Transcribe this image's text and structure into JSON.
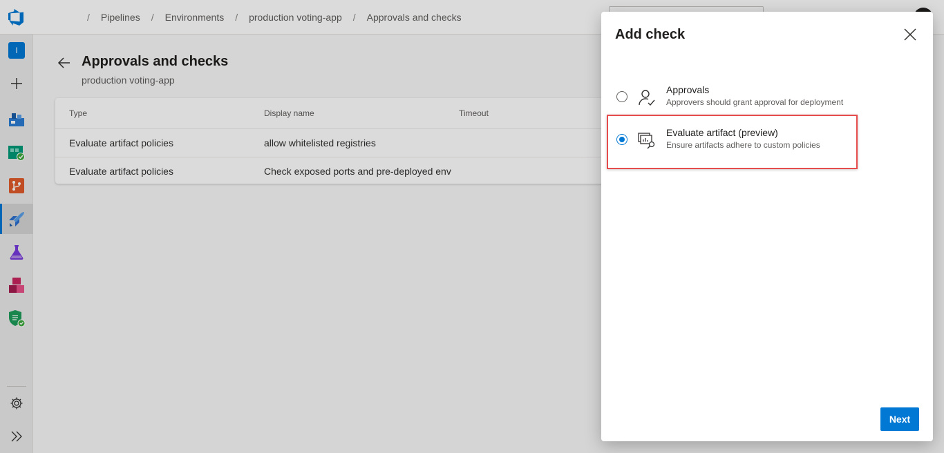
{
  "header": {
    "breadcrumbs": [
      {
        "label": "",
        "blurred": true
      },
      {
        "label": "",
        "blurred": true
      },
      {
        "label": "Pipelines",
        "blurred": false
      },
      {
        "label": "Environments",
        "blurred": false
      },
      {
        "label": "production voting-app",
        "blurred": false
      },
      {
        "label": "Approvals and checks",
        "blurred": false
      }
    ],
    "separator": "/"
  },
  "sidebar": {
    "project_initial": "I",
    "items": [
      {
        "icon": "project-badge"
      },
      {
        "icon": "plus-icon"
      },
      {
        "icon": "boards-icon"
      },
      {
        "icon": "boards-check-icon"
      },
      {
        "icon": "repos-icon"
      },
      {
        "icon": "pipelines-icon",
        "active": true
      },
      {
        "icon": "test-plans-icon"
      },
      {
        "icon": "artifacts-icon"
      },
      {
        "icon": "security-icon"
      }
    ],
    "bottom": [
      {
        "icon": "gear-icon"
      },
      {
        "icon": "expand-icon"
      }
    ]
  },
  "page": {
    "title": "Approvals and checks",
    "subtitle": "production voting-app"
  },
  "table": {
    "columns": [
      "Type",
      "Display name",
      "Timeout"
    ],
    "rows": [
      {
        "type": "Evaluate artifact policies",
        "display_name": "allow whitelisted registries",
        "timeout": ""
      },
      {
        "type": "Evaluate artifact policies",
        "display_name": "Check exposed ports and pre-deployed env",
        "timeout": ""
      }
    ]
  },
  "panel": {
    "title": "Add check",
    "options": [
      {
        "label": "Approvals",
        "description": "Approvers should grant approval for deployment",
        "icon": "person-check-icon",
        "selected": false
      },
      {
        "label": "Evaluate artifact (preview)",
        "description": "Ensure artifacts adhere to custom policies",
        "icon": "artifact-evaluate-icon",
        "selected": true
      }
    ],
    "next_label": "Next"
  },
  "colors": {
    "accent": "#0078d4",
    "highlight": "#e74c4c"
  }
}
